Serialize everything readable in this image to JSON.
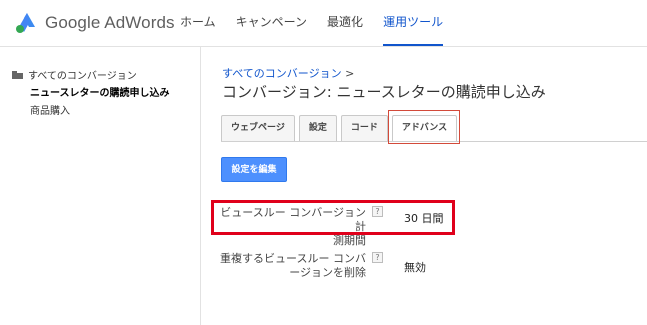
{
  "header": {
    "logo_text": "Google AdWords",
    "nav": [
      {
        "label": "ホーム"
      },
      {
        "label": "キャンペーン"
      },
      {
        "label": "最適化"
      },
      {
        "label": "運用ツール"
      }
    ],
    "active_nav_index": 3
  },
  "sidebar": {
    "root_label": "すべてのコンバージョン",
    "items": [
      {
        "label": "ニュースレターの購読申し込み",
        "selected": true
      },
      {
        "label": "商品購入",
        "selected": false
      }
    ]
  },
  "main": {
    "breadcrumb_link": "すべてのコンバージョン",
    "breadcrumb_sep": ">",
    "title": "コンバージョン: ニュースレターの購読申し込み",
    "tabs": [
      {
        "label": "ウェブページ"
      },
      {
        "label": "設定"
      },
      {
        "label": "コード"
      },
      {
        "label": "アドバンス"
      }
    ],
    "active_tab_index": 3,
    "edit_button": "設定を編集",
    "settings": [
      {
        "label_line1": "ビュースルー コンバージョン計",
        "label_line2": "測期間",
        "help": "?",
        "value": "30 日間"
      },
      {
        "label_line1": "重複するビュースルー コンバ",
        "label_line2": "ージョンを削除",
        "help": "?",
        "value": "無効"
      }
    ]
  },
  "colors": {
    "link_blue": "#1155cc",
    "button_blue": "#4d90fe",
    "highlight_red": "#e0001b"
  }
}
